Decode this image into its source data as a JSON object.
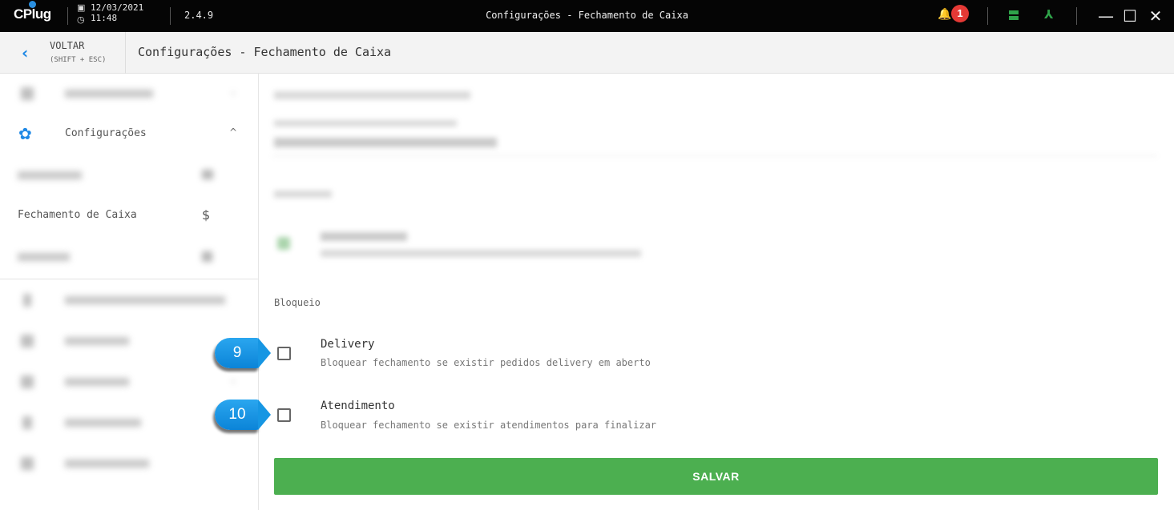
{
  "titlebar": {
    "logo": "CPlug",
    "date": "12/03/2021",
    "time": "11:48",
    "version": "2.4.9",
    "title": "Configurações - Fechamento de Caixa",
    "notification_count": "1"
  },
  "header": {
    "back_label": "VOLTAR",
    "back_hint": "(SHIFT + ESC)",
    "page_title": "Configurações - Fechamento de Caixa"
  },
  "sidebar": {
    "configuracoes_label": "Configurações",
    "fechamento_label": "Fechamento de Caixa",
    "fechamento_icon": "$"
  },
  "main": {
    "bloqueio_label": "Bloqueio",
    "options": [
      {
        "title": "Delivery",
        "description": "Bloquear fechamento se existir pedidos delivery em aberto",
        "checked": false
      },
      {
        "title": "Atendimento",
        "description": "Bloquear fechamento se existir atendimentos para finalizar",
        "checked": false
      }
    ],
    "save_label": "SALVAR"
  },
  "callouts": [
    "9",
    "10"
  ],
  "colors": {
    "accent": "#1e88e5",
    "save": "#4caf50",
    "badge": "#e53935",
    "callout": "#1696e3"
  }
}
